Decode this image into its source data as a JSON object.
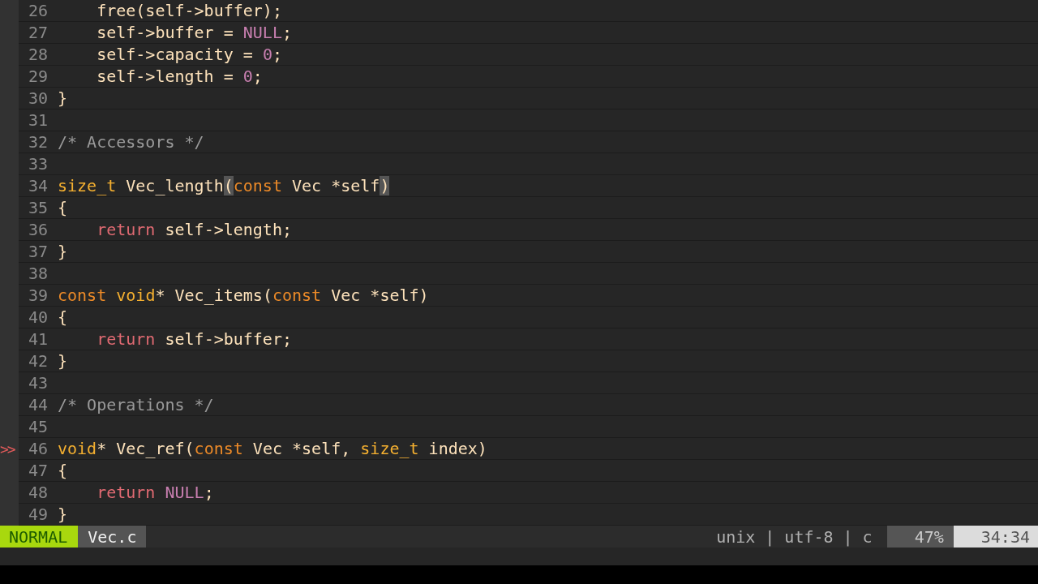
{
  "lines": [
    {
      "number": "26",
      "tokens": [
        {
          "kind": "plain",
          "text": "    free(self->buffer);"
        }
      ]
    },
    {
      "number": "27",
      "tokens": [
        {
          "kind": "plain",
          "text": "    self->buffer = "
        },
        {
          "kind": "constant",
          "text": "NULL"
        },
        {
          "kind": "plain",
          "text": ";"
        }
      ]
    },
    {
      "number": "28",
      "tokens": [
        {
          "kind": "plain",
          "text": "    self->capacity = "
        },
        {
          "kind": "constant",
          "text": "0"
        },
        {
          "kind": "plain",
          "text": ";"
        }
      ]
    },
    {
      "number": "29",
      "tokens": [
        {
          "kind": "plain",
          "text": "    self->length = "
        },
        {
          "kind": "constant",
          "text": "0"
        },
        {
          "kind": "plain",
          "text": ";"
        }
      ]
    },
    {
      "number": "30",
      "tokens": [
        {
          "kind": "plain",
          "text": "}"
        }
      ]
    },
    {
      "number": "31"
    },
    {
      "number": "32",
      "tokens": [
        {
          "kind": "comment",
          "text": "/* Accessors */"
        }
      ]
    },
    {
      "number": "33"
    },
    {
      "number": "34",
      "tokens": [
        {
          "kind": "type",
          "text": "size_t"
        },
        {
          "kind": "plain",
          "text": " Vec_length"
        },
        {
          "kind": "match",
          "text": "("
        },
        {
          "kind": "keyword",
          "text": "const"
        },
        {
          "kind": "plain",
          "text": " Vec *self"
        },
        {
          "kind": "match",
          "text": ")"
        }
      ]
    },
    {
      "number": "35",
      "tokens": [
        {
          "kind": "plain",
          "text": "{"
        }
      ]
    },
    {
      "number": "36",
      "tokens": [
        {
          "kind": "statement",
          "text": "    return"
        },
        {
          "kind": "plain",
          "text": " self->length;"
        }
      ]
    },
    {
      "number": "37",
      "tokens": [
        {
          "kind": "plain",
          "text": "}"
        }
      ]
    },
    {
      "number": "38"
    },
    {
      "number": "39",
      "tokens": [
        {
          "kind": "keyword",
          "text": "const"
        },
        {
          "kind": "type",
          "text": " void"
        },
        {
          "kind": "plain",
          "text": "* Vec_items("
        },
        {
          "kind": "keyword",
          "text": "const"
        },
        {
          "kind": "plain",
          "text": " Vec *self)"
        }
      ]
    },
    {
      "number": "40",
      "tokens": [
        {
          "kind": "plain",
          "text": "{"
        }
      ]
    },
    {
      "number": "41",
      "tokens": [
        {
          "kind": "statement",
          "text": "    return"
        },
        {
          "kind": "plain",
          "text": " self->buffer;"
        }
      ]
    },
    {
      "number": "42",
      "tokens": [
        {
          "kind": "plain",
          "text": "}"
        }
      ]
    },
    {
      "number": "43"
    },
    {
      "number": "44",
      "tokens": [
        {
          "kind": "comment",
          "text": "/* Operations */"
        }
      ]
    },
    {
      "number": "45"
    },
    {
      "number": "46",
      "sign": ">>",
      "tokens": [
        {
          "kind": "type",
          "text": "void"
        },
        {
          "kind": "plain",
          "text": "* Vec_ref("
        },
        {
          "kind": "keyword",
          "text": "const"
        },
        {
          "kind": "plain",
          "text": " Vec *self, "
        },
        {
          "kind": "type",
          "text": "size_t"
        },
        {
          "kind": "plain",
          "text": " index)"
        }
      ]
    },
    {
      "number": "47",
      "tokens": [
        {
          "kind": "plain",
          "text": "{"
        }
      ]
    },
    {
      "number": "48",
      "tokens": [
        {
          "kind": "statement",
          "text": "    return"
        },
        {
          "kind": "constant",
          "text": " NULL"
        },
        {
          "kind": "plain",
          "text": ";"
        }
      ]
    },
    {
      "number": "49",
      "tokens": [
        {
          "kind": "plain",
          "text": "}"
        }
      ]
    }
  ],
  "status_bar": {
    "mode": "NORMAL",
    "filename": "Vec.c",
    "fileformat": "unix",
    "separator_1": "|",
    "encoding": "utf-8",
    "separator_2": "|",
    "filetype": "c",
    "percent": "47%",
    "position": "34:34"
  }
}
